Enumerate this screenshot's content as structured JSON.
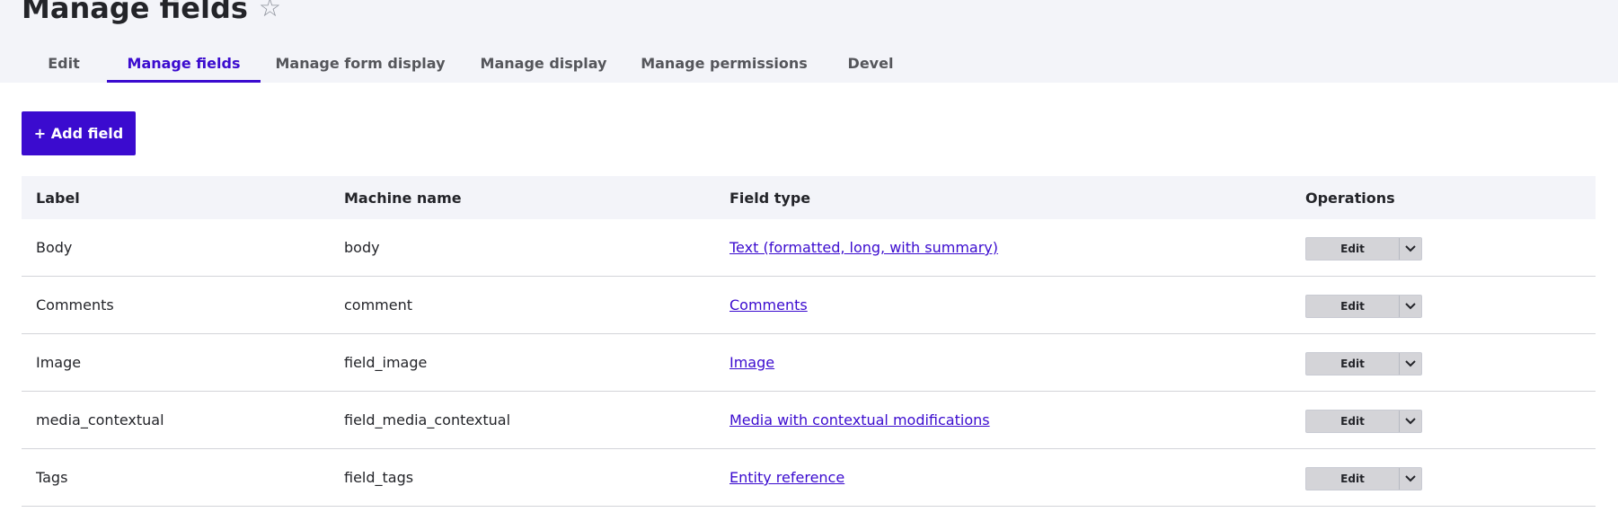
{
  "page": {
    "title": "Manage fields",
    "star_icon": "star-icon"
  },
  "tabs": [
    {
      "label": "Edit",
      "active": false
    },
    {
      "label": "Manage fields",
      "active": true
    },
    {
      "label": "Manage form display",
      "active": false
    },
    {
      "label": "Manage display",
      "active": false
    },
    {
      "label": "Manage permissions",
      "active": false
    },
    {
      "label": "Devel",
      "active": false
    }
  ],
  "actions": {
    "add_field_label": "+ Add field"
  },
  "table": {
    "headers": [
      "Label",
      "Machine name",
      "Field type",
      "Operations"
    ],
    "rows": [
      {
        "label": "Body",
        "machine_name": "body",
        "field_type": "Text (formatted, long, with summary)",
        "op": "Edit"
      },
      {
        "label": "Comments",
        "machine_name": "comment",
        "field_type": "Comments",
        "op": "Edit"
      },
      {
        "label": "Image",
        "machine_name": "field_image",
        "field_type": "Image",
        "op": "Edit"
      },
      {
        "label": "media_contextual",
        "machine_name": "field_media_contextual",
        "field_type": "Media with contextual modifications",
        "op": "Edit"
      },
      {
        "label": "Tags",
        "machine_name": "field_tags",
        "field_type": "Entity reference",
        "op": "Edit"
      }
    ]
  },
  "colors": {
    "accent": "#3b0bcf",
    "header_bg": "#f3f4f9",
    "button_gray": "#d4d4d8"
  }
}
